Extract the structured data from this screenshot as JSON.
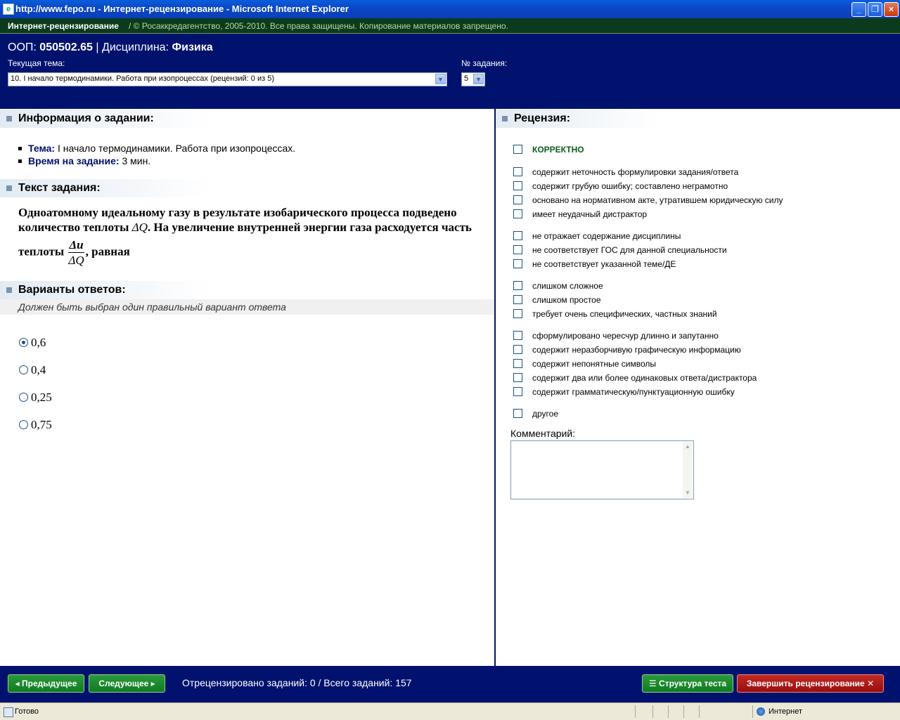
{
  "window": {
    "title": "http://www.fepo.ru - Интернет-рецензирование - Microsoft Internet Explorer"
  },
  "strip": {
    "brand": "Интернет-рецензирование",
    "copyright": "/ © Росаккредагентство, 2005-2010. Все права защищены. Копирование материалов запрещено."
  },
  "header": {
    "oop_label": "ООП:",
    "oop_value": "050502.65",
    "separator": "|",
    "discipline_label": "Дисциплина:",
    "discipline_value": "Физика",
    "topic_label": "Текущая тема:",
    "topic_selected": "10. I начало термодинамики. Работа при изопроцессах  (рецензий: 0 из 5)",
    "task_no_label": "№ задания:",
    "task_no_selected": "5"
  },
  "info": {
    "heading": "Информация о задании:",
    "topic_key": "Тема:",
    "topic_value": "I начало термодинамики. Работа при изопроцессах.",
    "time_key": "Время на задание:",
    "time_value": "3 мин."
  },
  "task": {
    "heading": "Текст задания:",
    "line1": "Одноатомному идеальному газу в результате изобарического процесса подведено",
    "line2a": "количество теплоты",
    "dq": "ΔQ",
    "line2b": ". На увеличение внутренней энергии газа расходуется часть",
    "line3a": "теплоты",
    "frac_num": "Δu",
    "frac_den": "ΔQ",
    "line3b": ", равная"
  },
  "answers": {
    "heading": "Варианты ответов:",
    "hint": "Должен быть выбран один правильный вариант ответа",
    "options": [
      "0,6",
      "0,4",
      "0,25",
      "0,75"
    ],
    "selected_index": 0
  },
  "review": {
    "heading": "Рецензия:",
    "correct": "КОРРЕКТНО",
    "items": [
      "содержит неточность формулировки задания/ответа",
      "содержит грубую ошибку; составлено неграмотно",
      "основано на нормативном акте, утратившем юридическую силу",
      "имеет неудачный дистрактор",
      "не отражает содержание дисциплины",
      "не соответствует ГОС для данной специальности",
      "не соответствует указанной теме/ДЕ",
      "слишком сложное",
      "слишком простое",
      "требует очень специфических, частных знаний",
      "сформулировано чересчур длинно и запутанно",
      "содержит неразборчивую графическую информацию",
      "содержит непонятные символы",
      "содержит два или более одинаковых ответа/дистрактора",
      "содержит грамматическую/пунктуационную ошибку",
      "другое"
    ],
    "comment_label": "Комментарий:"
  },
  "footer": {
    "prev": "Предыдущее",
    "next": "Следующее",
    "progress": "Отрецензировано заданий: 0 / Всего заданий:  157",
    "structure": "Структура теста",
    "finish": "Завершить рецензирование"
  },
  "status": {
    "text": "Готово",
    "zone": "Интернет"
  },
  "colors": {
    "header_bg": "#00126e",
    "strip_bg": "#0b3b1d",
    "button_green": "#117a24",
    "button_red": "#980e0e"
  }
}
